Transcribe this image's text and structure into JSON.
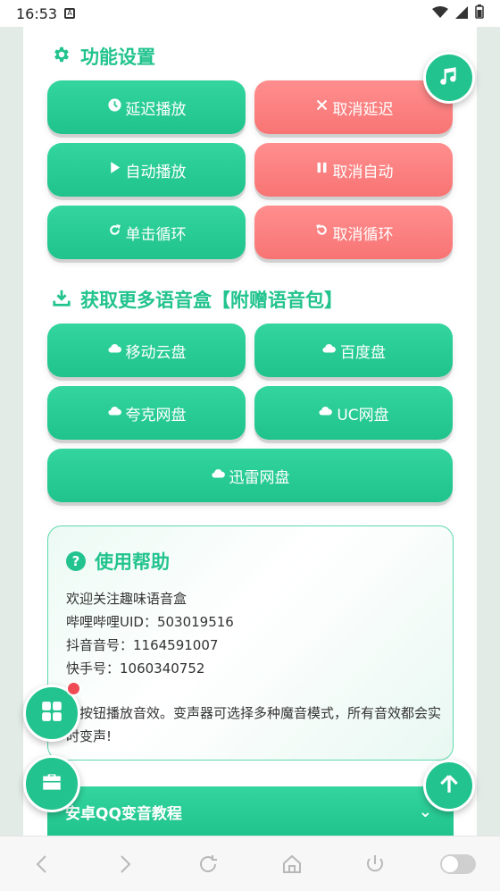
{
  "status_bar": {
    "time": "16:53"
  },
  "settings_section": {
    "title": "功能设置",
    "buttons": [
      {
        "label": "延迟播放",
        "icon": "clock-icon",
        "color": "green"
      },
      {
        "label": "取消延迟",
        "icon": "x-icon",
        "color": "red"
      },
      {
        "label": "自动播放",
        "icon": "play-icon",
        "color": "green"
      },
      {
        "label": "取消自动",
        "icon": "pause-icon",
        "color": "red"
      },
      {
        "label": "单击循环",
        "icon": "redo-icon",
        "color": "green"
      },
      {
        "label": "取消循环",
        "icon": "undo-icon",
        "color": "red"
      }
    ]
  },
  "download_section": {
    "title": "获取更多语音盒【附赠语音包】",
    "buttons": [
      {
        "label": "移动云盘",
        "icon": "cloud-icon"
      },
      {
        "label": "百度盘",
        "icon": "cloud-icon"
      },
      {
        "label": "夸克网盘",
        "icon": "cloud-icon"
      },
      {
        "label": "UC网盘",
        "icon": "cloud-icon"
      },
      {
        "label": "迅雷网盘",
        "icon": "cloud-icon"
      }
    ]
  },
  "help": {
    "title": "使用帮助",
    "lines": [
      "欢迎关注趣味语音盒",
      "哔哩哔哩UID：503019516",
      "抖音音号：1164591007",
      "快手号：1060340752"
    ],
    "description": "击按钮播放音效。变声器可选择多种魔音模式，所有音效都会实时变声!"
  },
  "tutorial": {
    "label": "安卓QQ变音教程"
  },
  "colors": {
    "accent": "#22c38e",
    "green_button": "#24c890",
    "red_button": "#fa7a7a",
    "badge": "#f04b55"
  },
  "icons": {
    "settings_title": "gear-icon",
    "download_title": "download-icon",
    "help_title": "question-icon",
    "fab_music": "music-note-icon",
    "fab_grid": "grid-icon",
    "fab_toolbox": "toolbox-icon",
    "fab_top": "arrow-up-icon",
    "nav": [
      "back-icon",
      "forward-icon",
      "refresh-icon",
      "home-icon",
      "power-icon",
      "toggle-icon"
    ]
  }
}
